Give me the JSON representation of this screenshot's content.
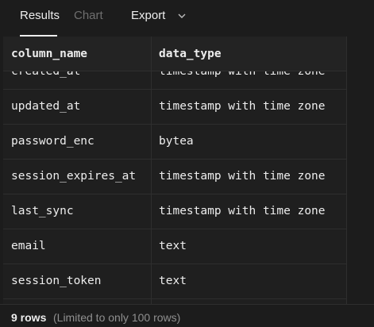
{
  "tabs": {
    "results": "Results",
    "chart": "Chart",
    "export": "Export"
  },
  "table": {
    "columns": [
      "column_name",
      "data_type"
    ],
    "rows": [
      [
        "created_at",
        "timestamp with time zone"
      ],
      [
        "updated_at",
        "timestamp with time zone"
      ],
      [
        "password_enc",
        "bytea"
      ],
      [
        "session_expires_at",
        "timestamp with time zone"
      ],
      [
        "last_sync",
        "timestamp with time zone"
      ],
      [
        "email",
        "text"
      ],
      [
        "session_token",
        "text"
      ]
    ]
  },
  "footer": {
    "count": "9 rows",
    "limit": "(Limited to only 100 rows)"
  }
}
